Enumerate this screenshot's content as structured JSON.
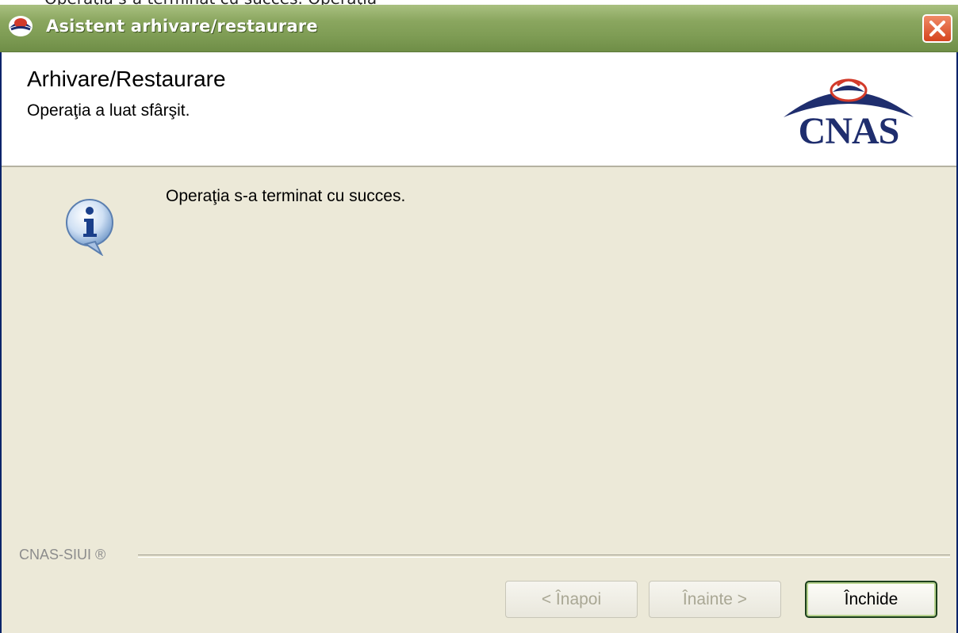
{
  "window": {
    "title": "Asistent arhivare/restaurare",
    "icon": "cnas-app-icon"
  },
  "header": {
    "title": "Arhivare/Restaurare",
    "subtitle": "Operaţia a luat sfârşit.",
    "logo_text": "CNAS"
  },
  "body": {
    "message": "Operaţia s-a terminat cu succes.",
    "icon": "info-icon"
  },
  "footer": {
    "label": "CNAS-SIUI ®"
  },
  "buttons": {
    "back": "< Înapoi",
    "next": "Înainte >",
    "close": "Închide"
  },
  "colors": {
    "titlebar": "#7f9d55",
    "logo": "#1f2e6e",
    "close_button": "#d5441f"
  }
}
